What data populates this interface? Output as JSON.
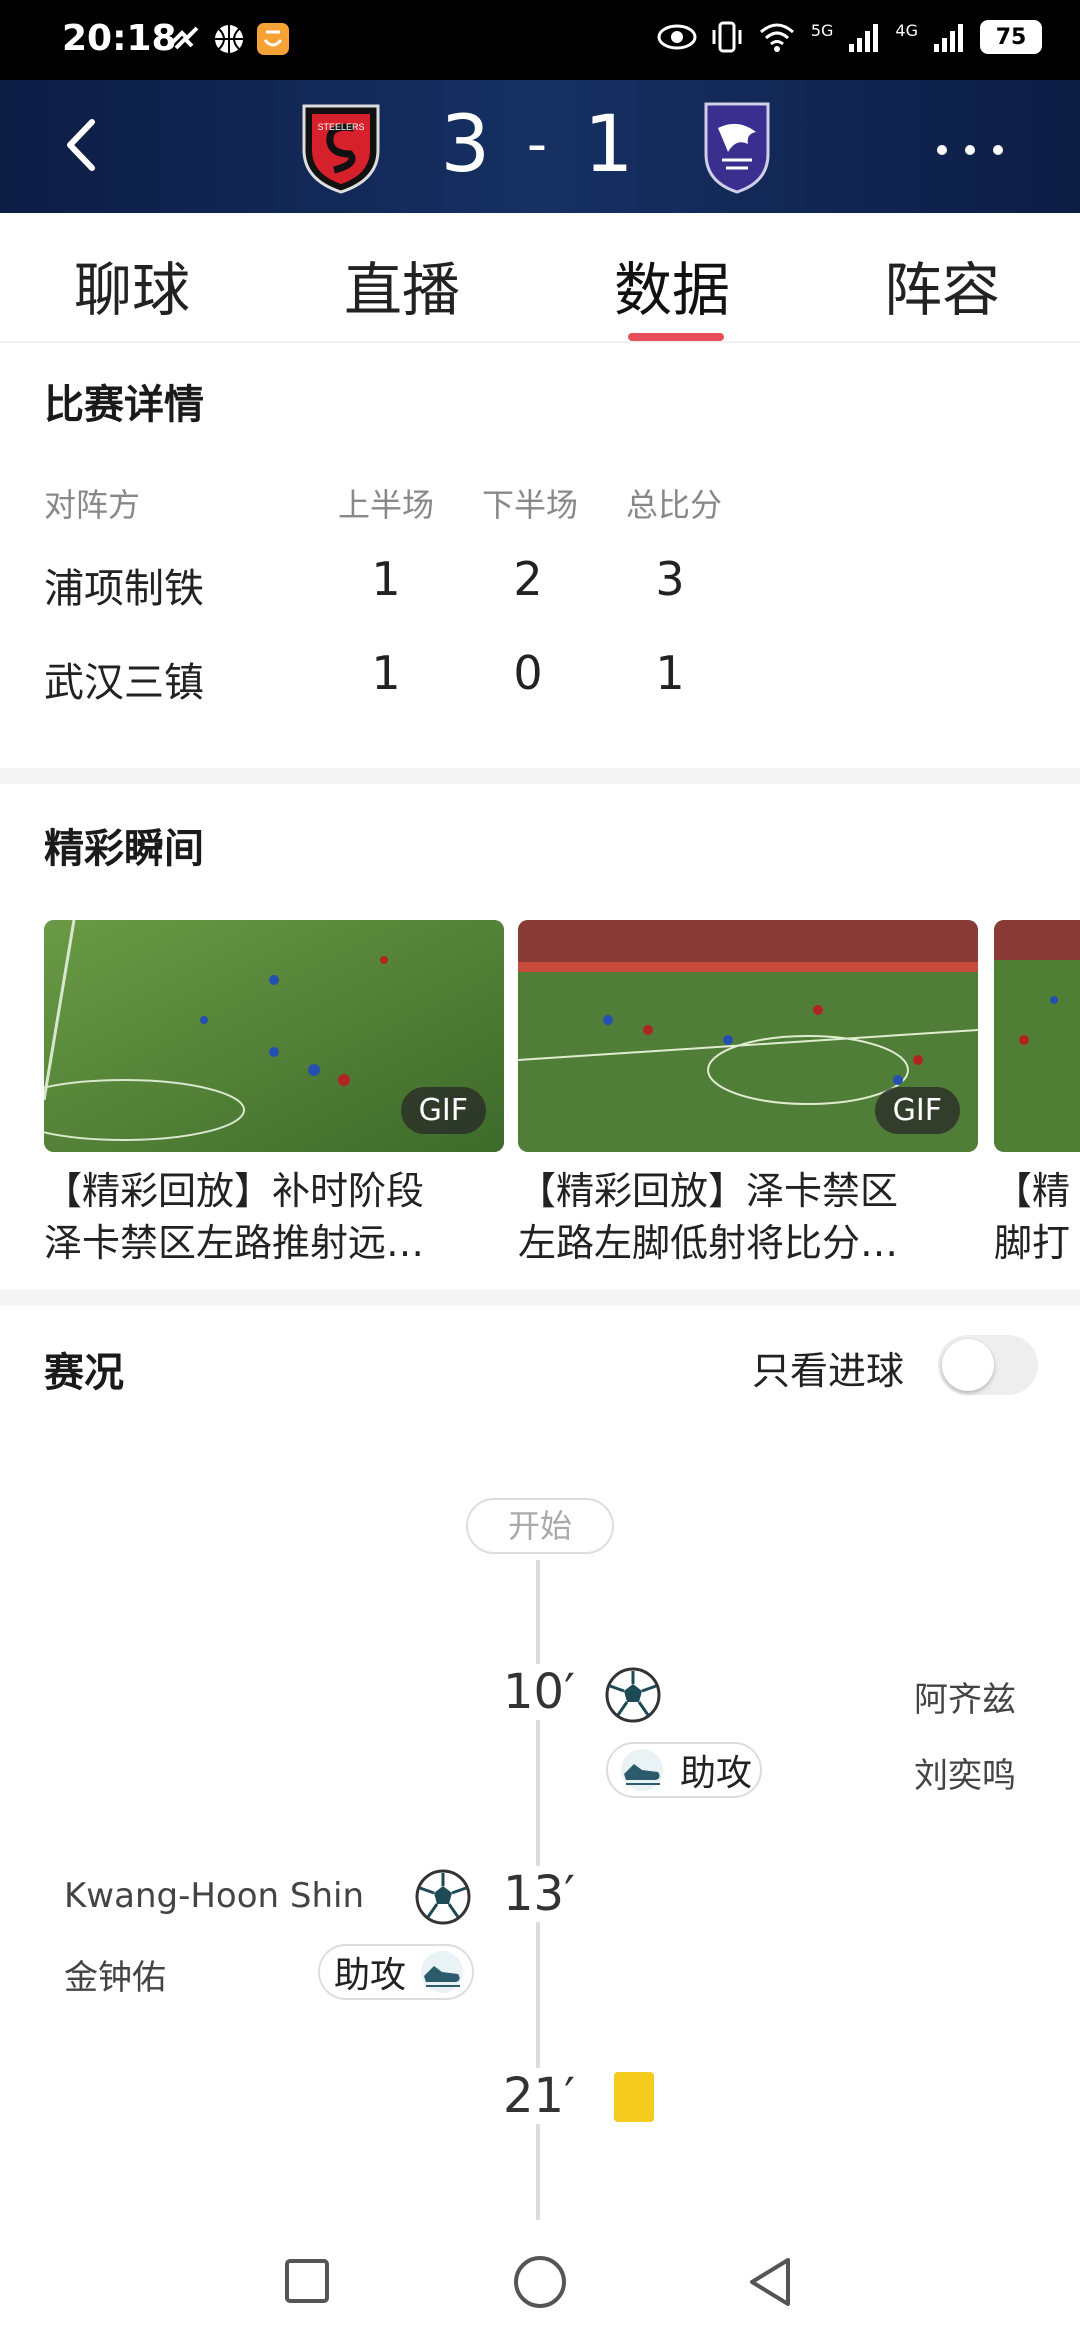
{
  "status_bar": {
    "time": "20:18",
    "signal_5g": "5G",
    "signal_4g": "4G",
    "battery": "75"
  },
  "header": {
    "score_home": "3",
    "score_sep": "-",
    "score_away": "1",
    "home_logo_text": "STEELERS",
    "accent_color": "#e7505b",
    "header_color": "#0c1d44"
  },
  "tabs": [
    "聊球",
    "直播",
    "数据",
    "阵容"
  ],
  "active_tab": "数据",
  "match_details": {
    "title": "比赛详情",
    "headers": [
      "对阵方",
      "上半场",
      "下半场",
      "总比分"
    ],
    "rows": [
      {
        "team": "浦项制铁",
        "first_half": "1",
        "second_half": "2",
        "total": "3"
      },
      {
        "team": "武汉三镇",
        "first_half": "1",
        "second_half": "0",
        "total": "1"
      }
    ]
  },
  "highlights": {
    "title": "精彩瞬间",
    "items": [
      {
        "badge": "GIF",
        "line1": "【精彩回放】补时阶段",
        "line2": "泽卡禁区左路推射远…"
      },
      {
        "badge": "GIF",
        "line1": "【精彩回放】泽卡禁区",
        "line2": "左路左脚低射将比分…"
      },
      {
        "badge": "",
        "line1": "【精",
        "line2": "脚打"
      }
    ]
  },
  "events": {
    "title": "赛况",
    "goals_only_label": "只看进球",
    "goals_only_enabled": false,
    "start_label": "开始",
    "items": [
      {
        "minute": "10′",
        "side": "away",
        "type": "goal",
        "scorer": "阿齐兹",
        "assist_label": "助攻",
        "assister": "刘奕鸣"
      },
      {
        "minute": "13′",
        "side": "home",
        "type": "goal",
        "scorer": "Kwang-Hoon Shin",
        "assist_label": "助攻",
        "assister": "金钟佑"
      },
      {
        "minute": "21′",
        "side": "away",
        "type": "yellow-card",
        "card_color": "#f5cc1d"
      }
    ]
  }
}
